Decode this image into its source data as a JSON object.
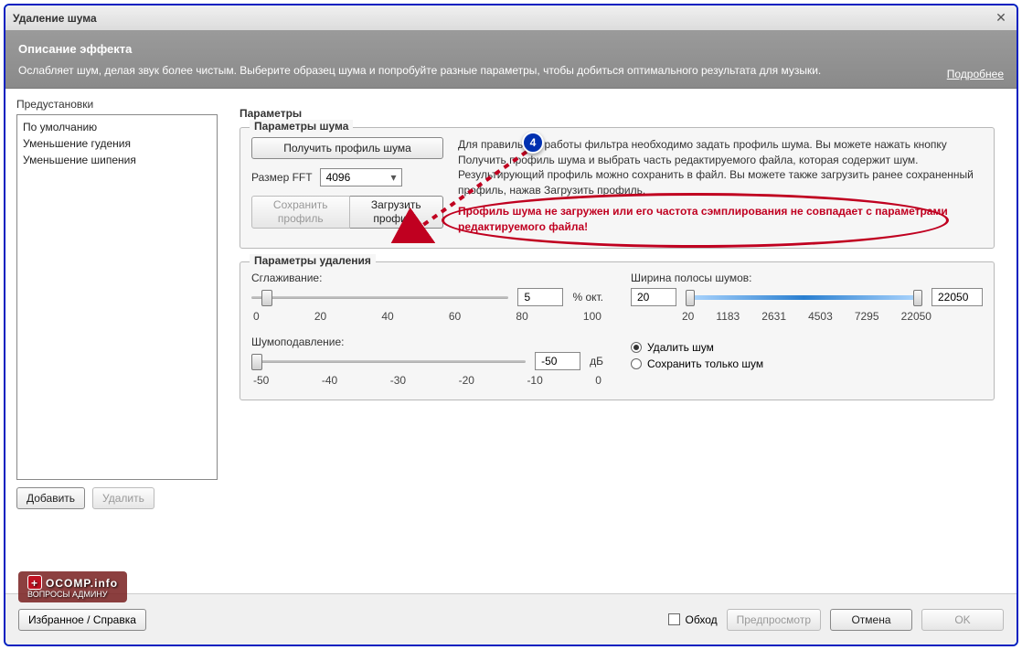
{
  "window": {
    "title": "Удаление шума"
  },
  "description": {
    "heading": "Описание эффекта",
    "text": "Ослабляет шум, делая звук более чистым. Выберите образец шума и попробуйте разные параметры, чтобы добиться оптимального результата для музыки.",
    "more": "Подробнее"
  },
  "presets": {
    "label": "Предустановки",
    "items": [
      "По умолчанию",
      "Уменьшение гудения",
      "Уменьшение шипения"
    ],
    "add": "Добавить",
    "remove": "Удалить"
  },
  "params": {
    "title": "Параметры",
    "noise": {
      "title": "Параметры шума",
      "get_profile": "Получить профиль шума",
      "fft_label": "Размер FFT",
      "fft_value": "4096",
      "save_profile": "Сохранить профиль",
      "load_profile": "Загрузить профиль",
      "info_text": "Для правильной работы фильтра необходимо задать профиль шума. Вы можете нажать кнопку Получить профиль шума и выбрать часть редактируемого файла, которая содержит шум. Результирующий профиль можно сохранить в файл. Вы можете также загрузить ранее сохраненный профиль, нажав Загрузить профиль.",
      "error_text": "Профиль шума не загружен или его частота сэмплирования не совпадает с параметрами редактируемого файла!"
    },
    "removal": {
      "title": "Параметры удаления",
      "smoothing_label": "Сглаживание:",
      "smoothing_value": "5",
      "smoothing_unit": "% окт.",
      "smoothing_ticks": [
        "0",
        "20",
        "40",
        "60",
        "80",
        "100"
      ],
      "reduction_label": "Шумоподавление:",
      "reduction_value": "-50",
      "reduction_unit": "дБ",
      "reduction_ticks": [
        "-50",
        "-40",
        "-30",
        "-20",
        "-10",
        "0"
      ],
      "band_label": "Ширина полосы шумов:",
      "band_low": "20",
      "band_high": "22050",
      "band_ticks": [
        "20",
        "1183",
        "2631",
        "4503",
        "7295",
        "22050"
      ],
      "radio_remove": "Удалить шум",
      "radio_keep": "Сохранить только шум"
    }
  },
  "footer": {
    "left_btn": "Избранное / Справка",
    "bypass": "Обход",
    "preview": "Предпросмотр",
    "cancel": "Отмена",
    "ok": "OK"
  },
  "annotation": {
    "number": "4"
  },
  "watermark": {
    "main": "OCOMP.info",
    "sub": "ВОПРОСЫ АДМИНУ"
  }
}
